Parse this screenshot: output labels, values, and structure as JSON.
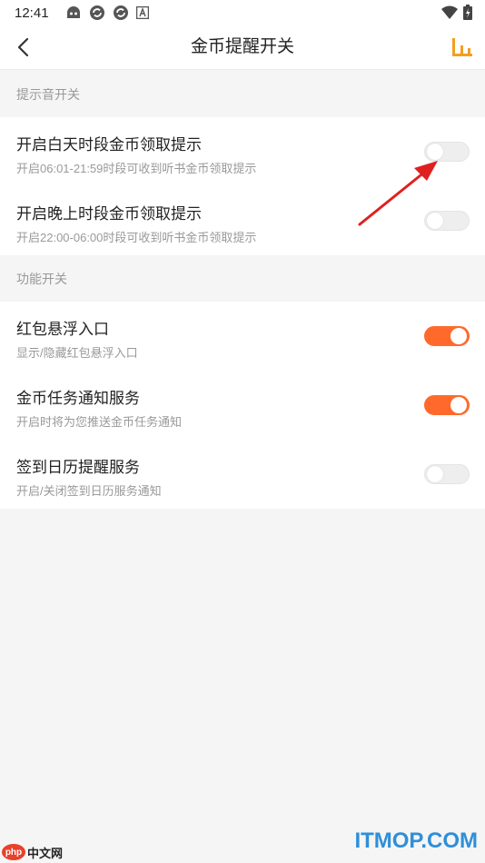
{
  "status_bar": {
    "time": "12:41",
    "icons": [
      "robot-icon",
      "sync-icon",
      "sync-icon",
      "a-icon"
    ],
    "right_icons": [
      "wifi-icon",
      "battery-icon"
    ]
  },
  "app_bar": {
    "title": "金币提醒开关",
    "back_icon": "back-arrow-icon",
    "right_icon": "stats-bar-icon",
    "accent_color": "#f0a020"
  },
  "sections": [
    {
      "header": "提示音开关",
      "items": [
        {
          "title": "开启白天时段金币领取提示",
          "subtitle": "开启06:01-21:59时段可收到听书金币领取提示",
          "on": false
        },
        {
          "title": "开启晚上时段金币领取提示",
          "subtitle": "开启22:00-06:00时段可收到听书金币领取提示",
          "on": false
        }
      ]
    },
    {
      "header": "功能开关",
      "items": [
        {
          "title": "红包悬浮入口",
          "subtitle": "显示/隐藏红包悬浮入口",
          "on": true
        },
        {
          "title": "金币任务通知服务",
          "subtitle": "开启时将为您推送金币任务通知",
          "on": true
        },
        {
          "title": "签到日历提醒服务",
          "subtitle": "开启/关闭签到日历服务通知",
          "on": false
        }
      ]
    }
  ],
  "toggle_on_color": "#ff6a2c",
  "annotation_arrow_color": "#e02020",
  "watermarks": {
    "left_badge": "php",
    "left_text": "中文网",
    "right_text": "ITMOP.COM"
  }
}
